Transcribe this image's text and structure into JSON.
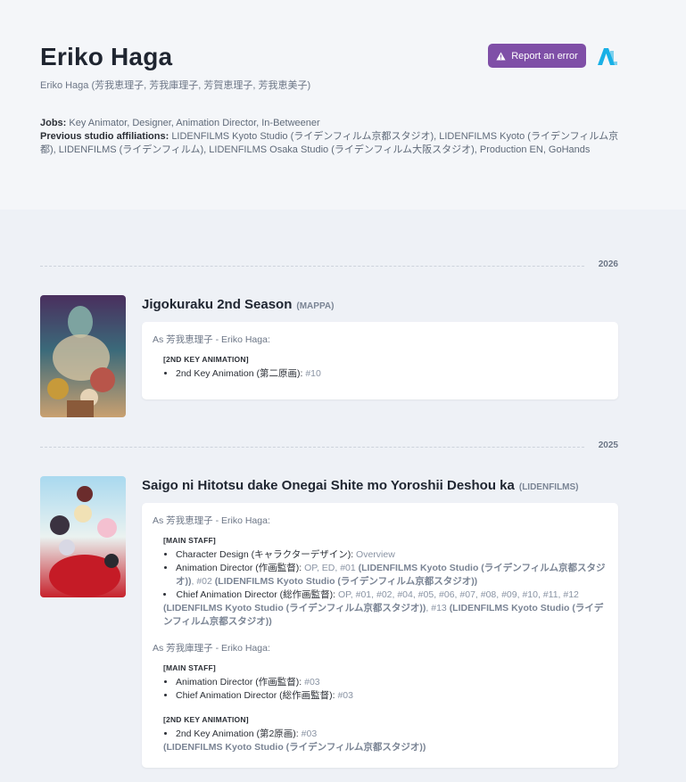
{
  "person": {
    "name": "Eriko Haga",
    "alt_names": "Eriko Haga (芳我恵理子, 芳我庫理子, 芳賀恵理子, 芳我恵美子)",
    "jobs_label": "Jobs:",
    "jobs": "Key Animator, Designer, Animation Director, In-Betweener",
    "affiliations_label": "Previous studio affiliations:",
    "affiliations": "LIDENFILMS Kyoto Studio (ライデンフィルム京都スタジオ), LIDENFILMS Kyoto (ライデンフィルム京都), LIDENFILMS (ライデンフィルム), LIDENFILMS Osaka Studio (ライデンフィルム大阪スタジオ), Production EN, GoHands"
  },
  "actions": {
    "report_label": "Report an error",
    "report_icon": "warning-icon",
    "logo_icon": "anilist-logo-icon",
    "accent": "#7f4fa7"
  },
  "years": [
    "2026",
    "2025"
  ],
  "entries": [
    {
      "title": "Jigokuraku 2nd Season",
      "studio": "(MAPPA)",
      "credits": [
        {
          "as": "As 芳我恵理子 - Eriko Haga:",
          "groups": [
            {
              "category": "[2ND KEY ANIMATION]",
              "roles": [
                {
                  "role": "2nd Key Animation (第二原画):",
                  "eps": "#10"
                }
              ]
            }
          ]
        }
      ]
    },
    {
      "title": "Saigo ni Hitotsu dake Onegai Shite mo Yoroshii Deshou ka",
      "studio": "(LIDENFILMS)",
      "credits": [
        {
          "as": "As 芳我恵理子 - Eriko Haga:",
          "groups": [
            {
              "category": "[MAIN STAFF]",
              "roles": [
                {
                  "role": "Character Design (キャラクターデザイン):",
                  "eps": "Overview"
                },
                {
                  "role": "Animation Director (作画監督):",
                  "eps": "OP, ED, #01",
                  "studio_a": "(LIDENFILMS Kyoto Studio (ライデンフィルム京都スタジオ))",
                  "eps_b": ", #02",
                  "studio_b": "(LIDENFILMS Kyoto Studio (ライデンフィルム京都スタジオ))"
                },
                {
                  "role": "Chief Animation Director (総作画監督):",
                  "eps": "OP, #01, #02, #04, #05, #06, #07, #08, #09, #10, #11, #12",
                  "studio_a": "(LIDENFILMS Kyoto Studio (ライデンフィルム京都スタジオ))",
                  "eps_b": ", #13",
                  "studio_b": "(LIDENFILMS Kyoto Studio (ライデンフィルム京都スタジオ))"
                }
              ]
            }
          ]
        },
        {
          "as": "As 芳我庫理子 - Eriko Haga:",
          "groups": [
            {
              "category": "[MAIN STAFF]",
              "roles": [
                {
                  "role": "Animation Director (作画監督):",
                  "eps": "#03"
                },
                {
                  "role": "Chief Animation Director (総作画監督):",
                  "eps": "#03"
                }
              ]
            },
            {
              "category": "[2ND KEY ANIMATION]",
              "roles": [
                {
                  "role": "2nd Key Animation (第2原画):",
                  "eps": "#03"
                }
              ],
              "studio": "(LIDENFILMS Kyoto Studio (ライデンフィルム京都スタジオ))"
            }
          ]
        }
      ]
    }
  ]
}
